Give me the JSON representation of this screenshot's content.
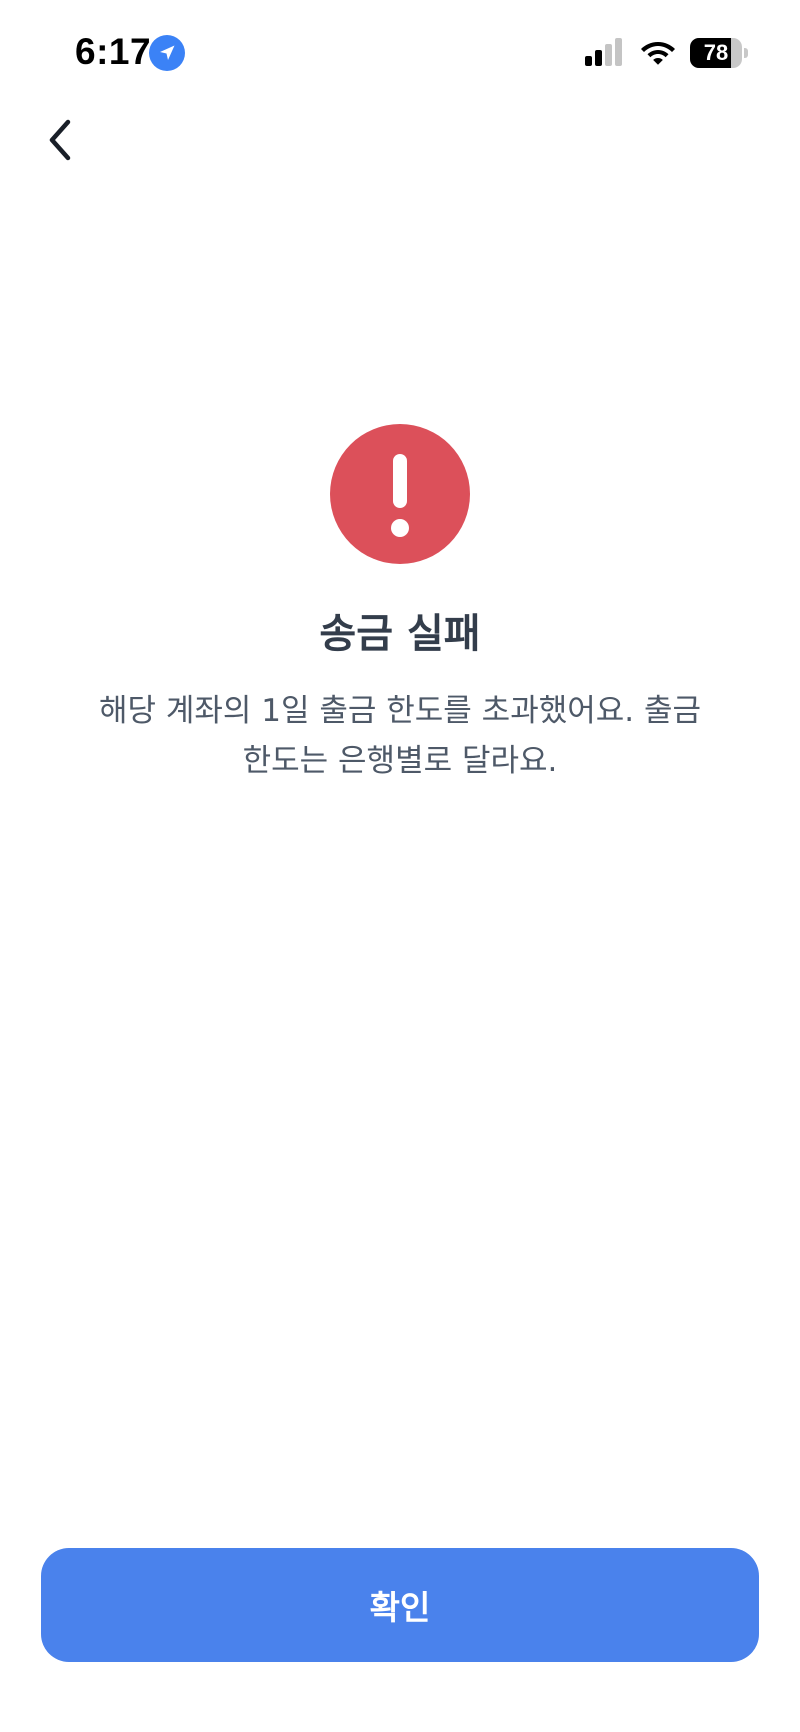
{
  "status_bar": {
    "time": "6:17",
    "location_icon": "location-arrow-icon",
    "signal_icon": "cellular-signal-icon",
    "signal_bars_active": 2,
    "signal_bars_total": 4,
    "wifi_icon": "wifi-icon",
    "battery_icon": "battery-icon",
    "battery_level": "78",
    "battery_fraction": 0.78
  },
  "nav": {
    "back_icon": "chevron-left-icon"
  },
  "result": {
    "icon": "exclamation-icon",
    "icon_color": "#dc505a",
    "title": "송금 실패",
    "message_line1": "해당 계좌의 1일 출금 한도를 초과했어요. 출금",
    "message_line2": "한도는 은행별로 달라요."
  },
  "actions": {
    "confirm_label": "확인",
    "confirm_color": "#4a82ec"
  }
}
